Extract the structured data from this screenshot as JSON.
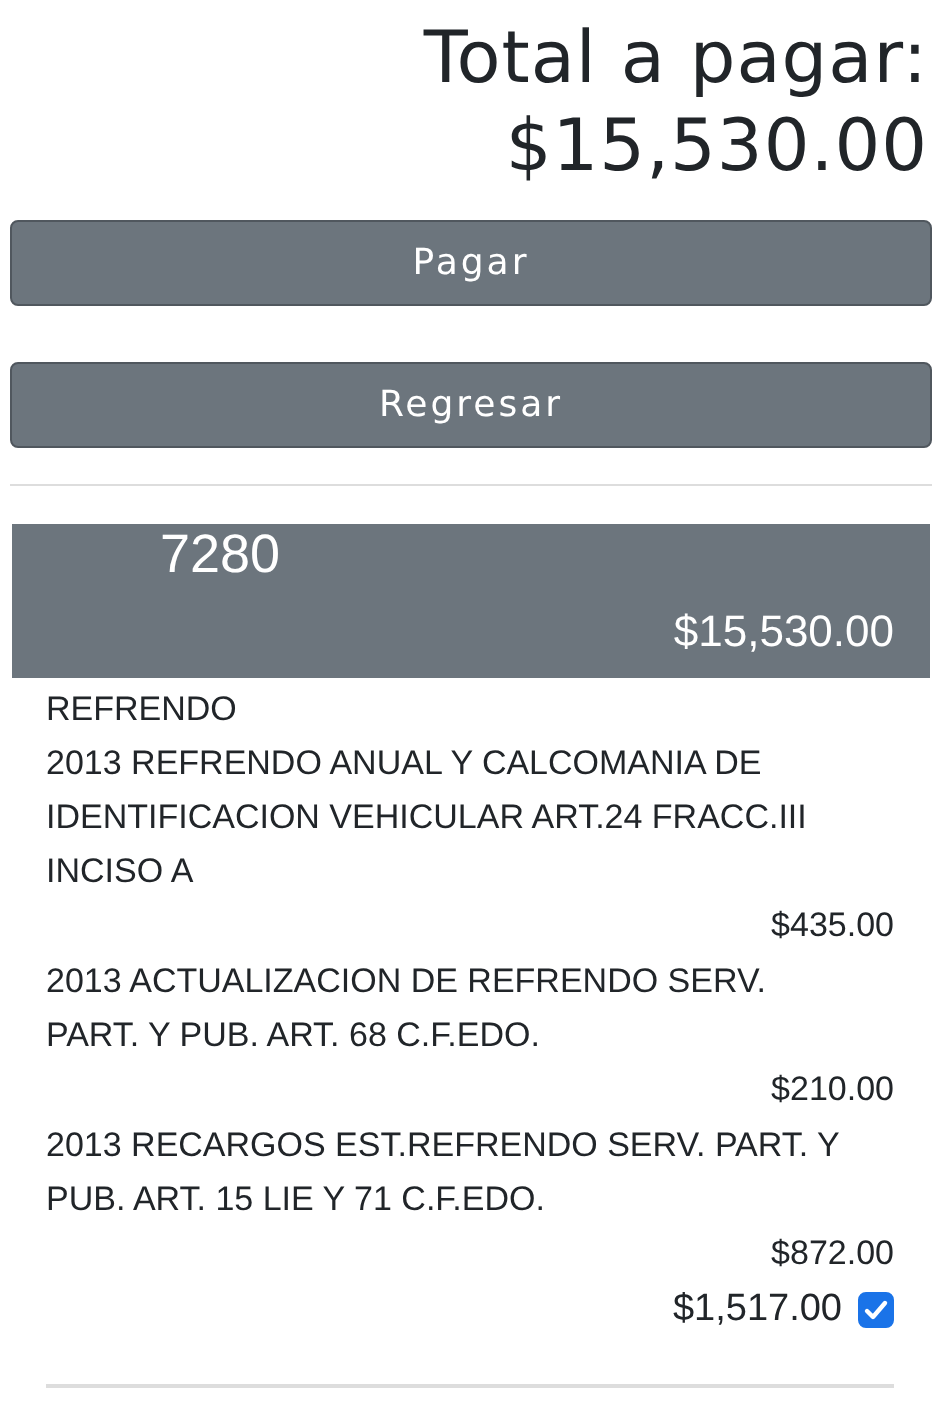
{
  "total": {
    "label": "Total a pagar:",
    "amount": "$15,530.00"
  },
  "buttons": [
    {
      "label": "Pagar"
    },
    {
      "label": "Regresar"
    }
  ],
  "account": {
    "number": "7280",
    "amount": "$15,530.00"
  },
  "section": {
    "title": "REFRENDO",
    "items": [
      {
        "description": "2013 REFRENDO ANUAL Y CALCOMANIA DE IDENTIFICACION VEHICULAR ART.24 FRACC.III INCISO A",
        "amount": "$435.00"
      },
      {
        "description": "2013 ACTUALIZACION DE REFRENDO SERV. PART. Y PUB. ART. 68 C.F.EDO.",
        "amount": "$210.00"
      },
      {
        "description": "2013 RECARGOS EST.REFRENDO SERV. PART. Y PUB. ART. 15 LIE Y 71 C.F.EDO.",
        "amount": "$872.00"
      }
    ],
    "subtotal": "$1,517.00",
    "checked": true
  }
}
